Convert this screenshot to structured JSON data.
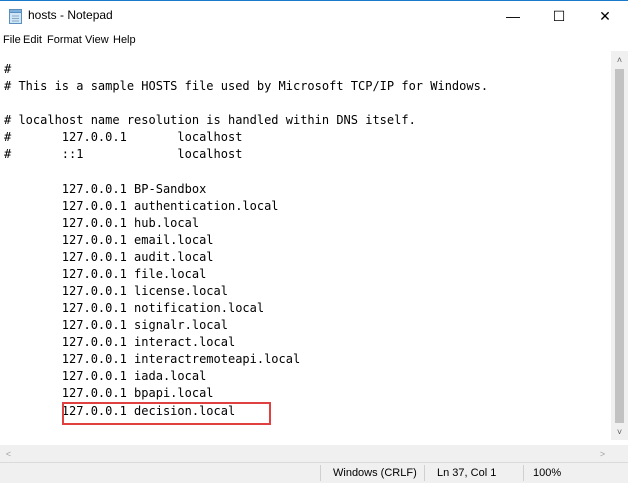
{
  "window": {
    "title": "hosts - Notepad",
    "controls": {
      "minimize": "—",
      "maximize": "☐",
      "close": "✕"
    }
  },
  "menu": [
    "File",
    "Edit",
    "Format",
    "View",
    "Help"
  ],
  "editor": {
    "lines": [
      "#",
      "# This is a sample HOSTS file used by Microsoft TCP/IP for Windows.",
      "",
      "# localhost name resolution is handled within DNS itself.",
      "#       127.0.0.1       localhost",
      "#       ::1             localhost",
      "",
      "        127.0.0.1 BP-Sandbox",
      "        127.0.0.1 authentication.local",
      "        127.0.0.1 hub.local",
      "        127.0.0.1 email.local",
      "        127.0.0.1 audit.local",
      "        127.0.0.1 file.local",
      "        127.0.0.1 license.local",
      "        127.0.0.1 notification.local",
      "        127.0.0.1 signalr.local",
      "        127.0.0.1 interact.local",
      "        127.0.0.1 interactremoteapi.local",
      "        127.0.0.1 iada.local",
      "        127.0.0.1 bpapi.local",
      "        127.0.0.1 decision.local"
    ]
  },
  "scrollbars": {
    "up": "˄",
    "down": "˅",
    "left": "<",
    "right": ">"
  },
  "status": {
    "encoding": "Windows (CRLF)",
    "position": "Ln 37, Col 1",
    "zoom": "100%"
  },
  "colors": {
    "highlight": "#e04040",
    "accent": "#1979ca"
  }
}
